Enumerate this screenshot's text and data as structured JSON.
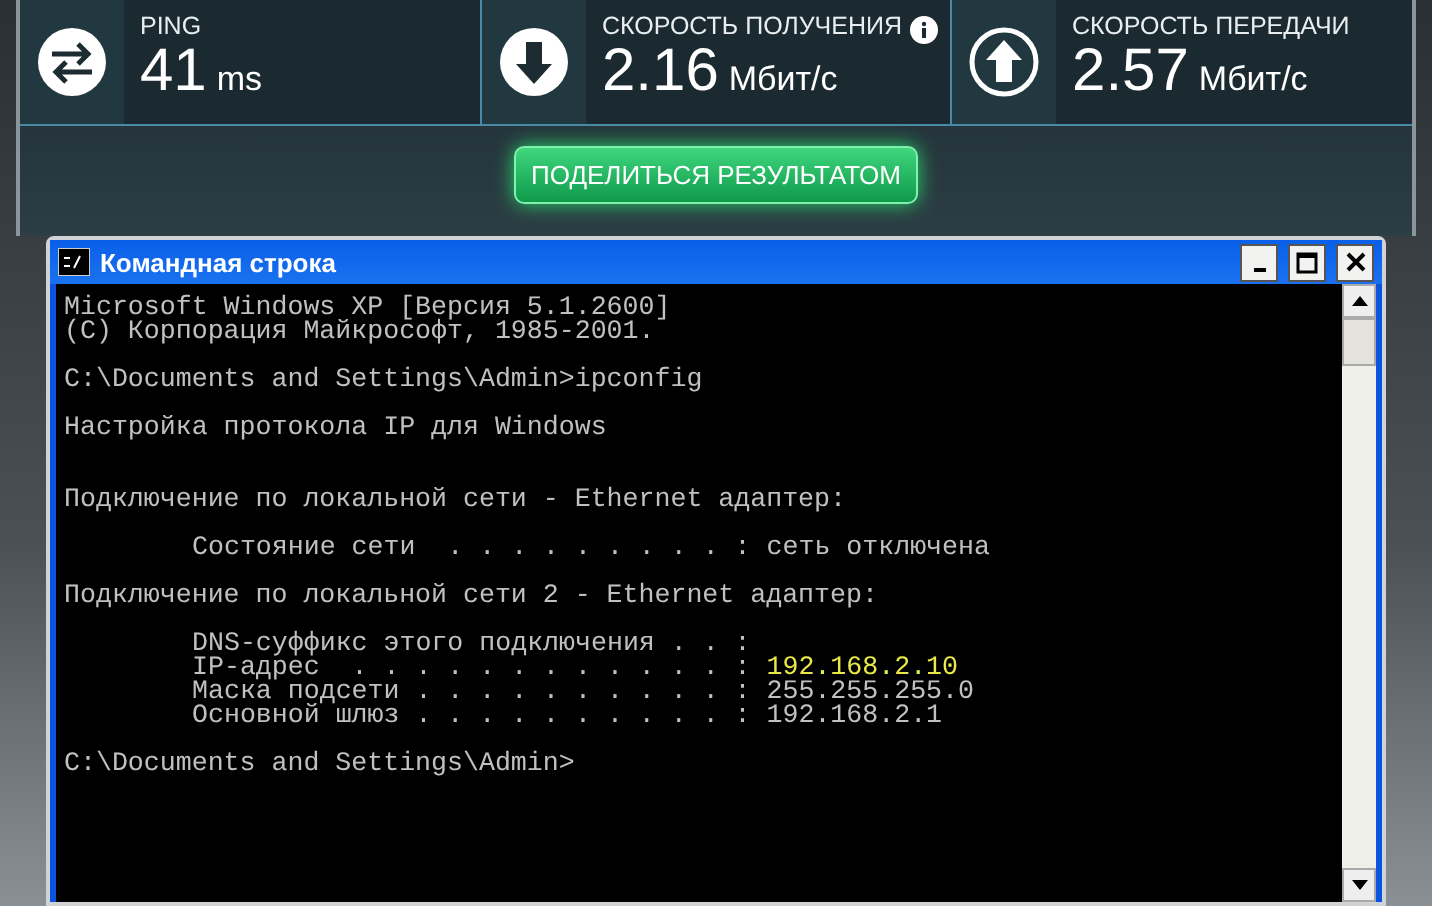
{
  "speedtest": {
    "metrics": [
      {
        "kind": "ping",
        "label": "PING",
        "value": "41",
        "unit": "ms",
        "info": false
      },
      {
        "kind": "download",
        "label": "СКОРОСТЬ ПОЛУЧЕНИЯ",
        "value": "2.16",
        "unit": "Мбит/с",
        "info": true
      },
      {
        "kind": "upload",
        "label": "СКОРОСТЬ ПЕРЕДАЧИ",
        "value": "2.57",
        "unit": "Мбит/с",
        "info": false
      }
    ],
    "share_button": "ПОДЕЛИТЬСЯ РЕЗУЛЬТАТОМ"
  },
  "console_window": {
    "title": "Командная строка",
    "lines": [
      {
        "kind": "plain",
        "text": "Microsoft Windows XP [Версия 5.1.2600]"
      },
      {
        "kind": "plain",
        "text": "(C) Корпорация Майкрософт, 1985-2001."
      },
      {
        "kind": "blank"
      },
      {
        "kind": "plain",
        "text": "C:\\Documents and Settings\\Admin>ipconfig"
      },
      {
        "kind": "blank"
      },
      {
        "kind": "plain",
        "text": "Настройка протокола IP для Windows"
      },
      {
        "kind": "blank"
      },
      {
        "kind": "blank"
      },
      {
        "kind": "plain",
        "text": "Подключение по локальной сети - Ethernet адаптер:"
      },
      {
        "kind": "blank"
      },
      {
        "kind": "field",
        "text": "Состояние сети  . . . . . . . . . :",
        "value": "сеть отключена",
        "highlighted": false
      },
      {
        "kind": "blank"
      },
      {
        "kind": "plain",
        "text": "Подключение по локальной сети 2 - Ethernet адаптер:"
      },
      {
        "kind": "blank"
      },
      {
        "kind": "field",
        "text": "DNS-суффикс этого подключения . . :"
      },
      {
        "kind": "field",
        "text": "IP-адрес  . . . . . . . . . . . . :",
        "value": "192.168.2.10",
        "highlighted": true
      },
      {
        "kind": "field",
        "text": "Маска подсети . . . . . . . . . . :",
        "value": "255.255.255.0",
        "highlighted": false
      },
      {
        "kind": "field",
        "text": "Основной шлюз . . . . . . . . . . :",
        "value": "192.168.2.1",
        "highlighted": false
      },
      {
        "kind": "blank"
      },
      {
        "kind": "plain",
        "text": "C:\\Documents and Settings\\Admin>"
      }
    ]
  }
}
